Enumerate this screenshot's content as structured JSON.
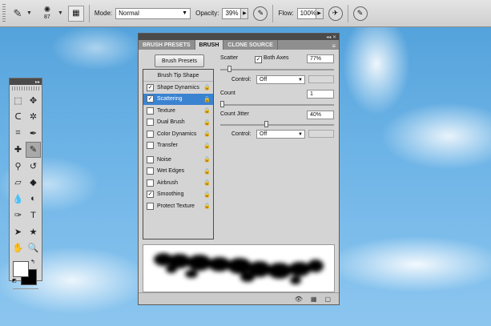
{
  "options_bar": {
    "brush_size": "87",
    "mode_label": "Mode:",
    "mode_value": "Normal",
    "opacity_label": "Opacity:",
    "opacity_value": "39%",
    "flow_label": "Flow:",
    "flow_value": "100%"
  },
  "brush_panel": {
    "tabs": [
      {
        "label": "BRUSH PRESETS"
      },
      {
        "label": "BRUSH"
      },
      {
        "label": "CLONE SOURCE"
      }
    ],
    "brush_presets_button": "Brush Presets",
    "list_header": "Brush Tip Shape",
    "options": [
      {
        "label": "Shape Dynamics",
        "checked": "✓"
      },
      {
        "label": "Scattering",
        "checked": "✓"
      },
      {
        "label": "Texture",
        "checked": ""
      },
      {
        "label": "Dual Brush",
        "checked": ""
      },
      {
        "label": "Color Dynamics",
        "checked": ""
      },
      {
        "label": "Transfer",
        "checked": ""
      },
      {
        "label": "Noise",
        "checked": ""
      },
      {
        "label": "Wet Edges",
        "checked": ""
      },
      {
        "label": "Airbrush",
        "checked": ""
      },
      {
        "label": "Smoothing",
        "checked": "✓"
      },
      {
        "label": "Protect Texture",
        "checked": ""
      }
    ],
    "scatter_label": "Scatter",
    "both_axes_label": "Both Axes",
    "both_axes_checked": "✓",
    "scatter_value": "77%",
    "control_label": "Control:",
    "control_value": "Off",
    "count_label": "Count",
    "count_value": "1",
    "count_jitter_label": "Count Jitter",
    "count_jitter_value": "40%",
    "control2_label": "Control:",
    "control2_value": "Off"
  }
}
